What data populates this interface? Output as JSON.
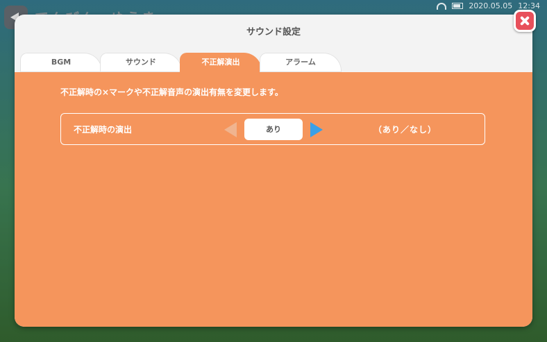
{
  "background": {
    "title": "てんびん　ゆうき"
  },
  "statusbar": {
    "date": "2020.05.05",
    "time": "12:34"
  },
  "dialog": {
    "title": "サウンド設定"
  },
  "tabs": [
    {
      "label": "BGM",
      "active": false
    },
    {
      "label": "サウンド",
      "active": false
    },
    {
      "label": "不正解演出",
      "active": true
    },
    {
      "label": "アラーム",
      "active": false
    }
  ],
  "panel": {
    "description": "不正解時の×マークや不正解音声の演出有無を変更します。",
    "setting": {
      "label": "不正解時の演出",
      "value": "あり",
      "options_text": "（あり／なし）"
    }
  },
  "colors": {
    "panel": "#f5955c",
    "close": "#e8505b",
    "arrow_active": "#3aa0e6",
    "arrow_disabled": "#f0b48f"
  }
}
